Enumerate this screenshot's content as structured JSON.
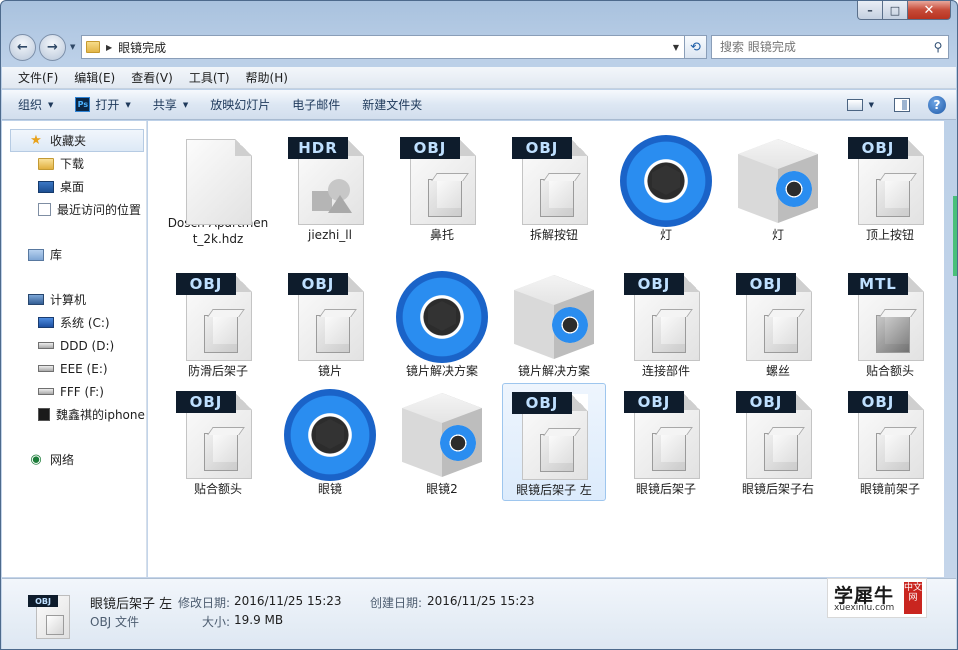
{
  "window": {
    "minimize_icon": "minimize-icon",
    "maximize_icon": "maximize-icon",
    "close_icon": "close-icon"
  },
  "nav": {
    "back_icon": "back-arrow-icon",
    "forward_icon": "forward-arrow-icon",
    "address": "眼镜完成",
    "search_placeholder": "搜索 眼镜完成"
  },
  "menu": {
    "items": [
      "文件(F)",
      "编辑(E)",
      "查看(V)",
      "工具(T)",
      "帮助(H)"
    ]
  },
  "toolbar": {
    "organize": "组织",
    "open": "打开",
    "share": "共享",
    "slideshow": "放映幻灯片",
    "email": "电子邮件",
    "new_folder": "新建文件夹"
  },
  "sidebar": {
    "favorites": "收藏夹",
    "downloads": "下载",
    "desktop": "桌面",
    "recent": "最近访问的位置",
    "libraries": "库",
    "computer": "计算机",
    "drive_c": "系统 (C:)",
    "drive_d": "DDD (D:)",
    "drive_e": "EEE (E:)",
    "drive_f": "FFF (F:)",
    "iphone": "魏鑫祺的iphone",
    "network": "网络"
  },
  "files": [
    {
      "name": "Dosch-Apartment_2k.hdz",
      "icon": "blank-file-icon"
    },
    {
      "name": "jiezhi_ll",
      "icon": "hdr-file-icon",
      "badge": "HDR"
    },
    {
      "name": "鼻托",
      "icon": "obj-file-icon",
      "badge": "OBJ"
    },
    {
      "name": "拆解按钮",
      "icon": "obj-file-icon",
      "badge": "OBJ"
    },
    {
      "name": "灯",
      "icon": "keyshot-lens-icon"
    },
    {
      "name": "灯",
      "icon": "keyshot-package-icon"
    },
    {
      "name": "顶上按钮",
      "icon": "obj-file-icon",
      "badge": "OBJ"
    },
    {
      "name": "防滑后架子",
      "icon": "obj-file-icon",
      "badge": "OBJ"
    },
    {
      "name": "镜片",
      "icon": "obj-file-icon",
      "badge": "OBJ"
    },
    {
      "name": "镜片解决方案",
      "icon": "keyshot-lens-icon"
    },
    {
      "name": "镜片解决方案",
      "icon": "keyshot-package-icon"
    },
    {
      "name": "连接部件",
      "icon": "obj-file-icon",
      "badge": "OBJ"
    },
    {
      "name": "螺丝",
      "icon": "obj-file-icon",
      "badge": "OBJ"
    },
    {
      "name": "贴合额头",
      "icon": "mtl-file-icon",
      "badge": "MTL"
    },
    {
      "name": "贴合额头",
      "icon": "obj-file-icon",
      "badge": "OBJ"
    },
    {
      "name": "眼镜",
      "icon": "keyshot-lens-icon"
    },
    {
      "name": "眼镜2",
      "icon": "keyshot-package-icon"
    },
    {
      "name": "眼镜后架子 左",
      "icon": "obj-file-icon",
      "badge": "OBJ",
      "selected": true
    },
    {
      "name": "眼镜后架子",
      "icon": "obj-file-icon",
      "badge": "OBJ"
    },
    {
      "name": "眼镜后架子右",
      "icon": "obj-file-icon",
      "badge": "OBJ"
    },
    {
      "name": "眼镜前架子",
      "icon": "obj-file-icon",
      "badge": "OBJ"
    }
  ],
  "details": {
    "badge": "OBJ",
    "name": "眼镜后架子 左",
    "type": "OBJ 文件",
    "modified_label": "修改日期:",
    "modified_value": "2016/11/25 15:23",
    "size_label": "大小:",
    "size_value": "19.9 MB",
    "created_label": "创建日期:",
    "created_value": "2016/11/25 15:23"
  },
  "watermark": {
    "main": "学犀牛",
    "sub": "xuexiniu.com",
    "seal": "中文网"
  }
}
